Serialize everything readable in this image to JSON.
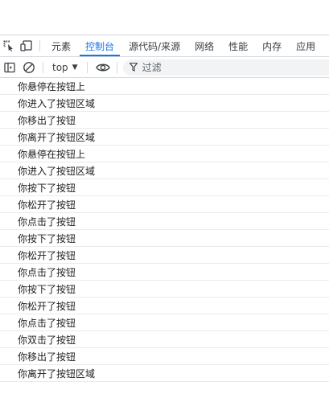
{
  "tabs": [
    {
      "label": "元素",
      "active": false
    },
    {
      "label": "控制台",
      "active": true
    },
    {
      "label": "源代码/来源",
      "active": false
    },
    {
      "label": "网络",
      "active": false
    },
    {
      "label": "性能",
      "active": false
    },
    {
      "label": "内存",
      "active": false
    },
    {
      "label": "应用",
      "active": false
    }
  ],
  "toolbar": {
    "context": "top",
    "filter_placeholder": "过滤"
  },
  "console": {
    "messages": [
      "你悬停在按钮上",
      "你进入了按钮区域",
      "你移出了按钮",
      "你离开了按钮区域",
      "你悬停在按钮上",
      "你进入了按钮区域",
      "你按下了按钮",
      "你松开了按钮",
      "你点击了按钮",
      "你按下了按钮",
      "你松开了按钮",
      "你点击了按钮",
      "你按下了按钮",
      "你松开了按钮",
      "你点击了按钮",
      "你双击了按钮",
      "你移出了按钮",
      "你离开了按钮区域"
    ]
  },
  "colors": {
    "accent": "#1a73e8",
    "border": "#d3d7dc",
    "row_divider": "#e8eaed"
  }
}
